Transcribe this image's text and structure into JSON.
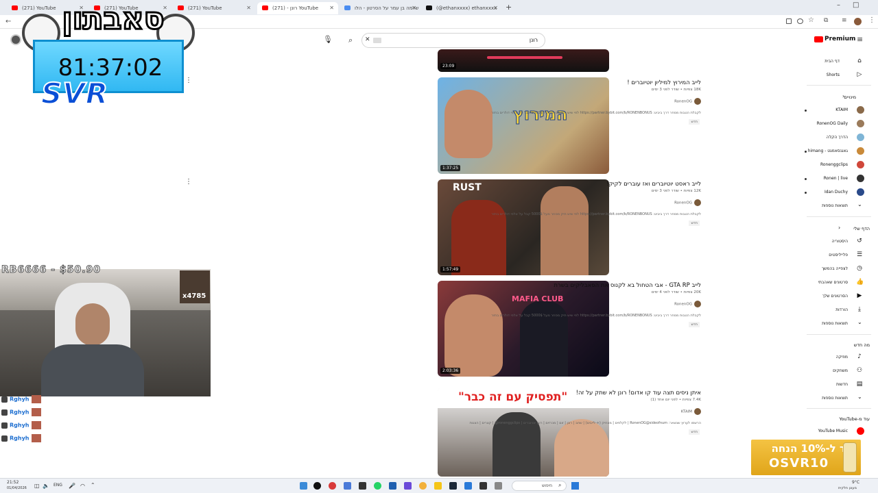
{
  "browser": {
    "tabs": [
      {
        "label": "(271) YouTube",
        "active": false
      },
      {
        "label": "(271) YouTube",
        "active": false
      },
      {
        "label": "(271) YouTube",
        "active": false
      },
      {
        "label": "רונן - (271) YouTube",
        "active": true
      },
      {
        "label": "שלמה בן עמר על הסרטון - הלו",
        "active": false
      },
      {
        "label": "(@ethanxxxx) ethanxxxx",
        "active": false
      }
    ],
    "new_tab_label": "+"
  },
  "youtube": {
    "logo_label": "Premium",
    "search_value": "רונן",
    "clear_label": "✕"
  },
  "videos": [
    {
      "title": "",
      "duration": "23:09"
    },
    {
      "title": "לייב המירוץ למיליון יוטיוברים !",
      "meta": "18K צפיות • שודר לפני 3 ימים",
      "channel": "RonenOG",
      "description": "לקבלת הטבות מסחר דרך ביביט: https://partner.bybit.com/b/RONENBONUS לפי שיש תיק מסחר מעל 5000$ קבל על אלפי דולרים בחזר",
      "badge": "חדש",
      "duration": "1:37:25",
      "thumb_text": "המירוץ"
    },
    {
      "title": "לייב ראסט יוטיוברים ואז עוברים לקיק!",
      "meta": "12K צפיות • שודר לפני 3 ימים",
      "channel": "RonenOG",
      "description": "לקבלת הטבות מסחר דרך ביביט: https://partner.bybit.com/b/RONENBONUS לפי שיש תיק מסחר מעל 5000$ קבל על אלפי דולרים בחזר",
      "badge": "חדש",
      "duration": "1:57:49",
      "thumb_text": "RUST"
    },
    {
      "title": "לייב GTA RP - אבי הטחול בא לקנוס את הפאבליקים בשרת",
      "meta": "20K צפיות • שודר לפני 4 ימים",
      "channel": "RonenOG",
      "description": "לקבלת הטבות מסחר דרך ביביט: https://partner.bybit.com/b/RONENBONUS לפי שיש תיק מסחר מעל 5000$ קבל על אלפי דולרים בחזר",
      "badge": "חדש",
      "duration": "2:03:36",
      "thumb_text": "MAFIA CLUB"
    },
    {
      "title": "איתן ניסים תצה עוד קו אדום! רונן לא שתק על זה!",
      "meta": "7.4K צפיות • לפני יום אחד (1)",
      "channel": "KTAIM",
      "description": "הרשמו לערוץ שנשאר: RonenOG@sideofnum | לקלפים | מצחיק (+-לייבים) | שחב | רונן | זום | מכרזים | רונן יוטיוברים | ronenggclips@ | קצרים | הצגות",
      "badge": "חדש",
      "duration": "",
      "thumb_text": "\"תפסיק עם זה כבר\""
    }
  ],
  "sidebar": {
    "home": "דף הבית",
    "shorts": "Shorts",
    "subs_header": "מינויים",
    "subscriptions": [
      {
        "name": "KTAIM",
        "color": "#8a6a4a",
        "live": true
      },
      {
        "name": "RonenOG Daily",
        "color": "#9b7b5b",
        "live": false
      },
      {
        "name": "הדרך הקלה",
        "color": "#7fb5d6",
        "live": false
      },
      {
        "name": "גאגנסאמגט - himang",
        "color": "#c98a3a",
        "live": true
      },
      {
        "name": "Ronenggclips",
        "color": "#d0473a",
        "live": false
      },
      {
        "name": "Ronen | live",
        "color": "#333333",
        "live": true
      },
      {
        "name": "Idan Duchy",
        "color": "#2a4a8a",
        "live": true
      }
    ],
    "show_more_1": "תוצאות נוספות",
    "you_header": "הדף שלי",
    "you_items": [
      "היסטוריה",
      "פלייליסטים",
      "לצפייה בהמשך",
      "סרטונים שאהבתי",
      "הסרטונים שלך",
      "הורדות",
      "תוצאות נוספות"
    ],
    "explore_header": "מה חדש",
    "explore_items": [
      "מוזיקה",
      "משחקים",
      "חדשות",
      "תוצאות נוספות"
    ],
    "more_from_header": "עוד מ-YouTube",
    "more_from_items": [
      "YouTube Music"
    ]
  },
  "overlay": {
    "hebrew_logo": "סאבתון",
    "timer": "81:37:02",
    "svr": "SVR",
    "donation": "RB6666 - $50.90",
    "gift_count": "x4785",
    "chat_lines": [
      "Rghyh",
      "Rghyh",
      "Rghyh",
      "Rghyh",
      "Rghyh"
    ],
    "promo_line1": "קוד ל-10% הנחה",
    "promo_line2": "OSVR10"
  },
  "taskbar": {
    "time": "21:52",
    "date": "01/04/2026",
    "search_label": "חיפוש",
    "weather": "9°C",
    "weather_desc": "מעונן חלקית",
    "lang": "ENG"
  }
}
